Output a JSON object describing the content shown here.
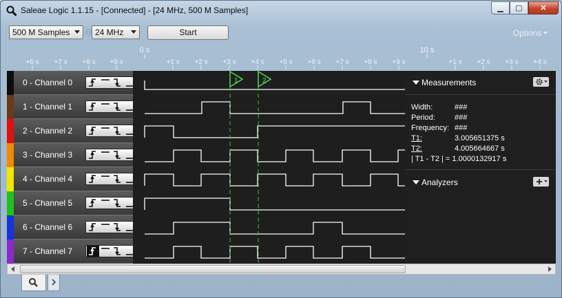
{
  "window": {
    "title": "Saleae Logic 1.1.15 - [Connected] - [24 MHz, 500 M Samples]"
  },
  "toolbar": {
    "samples_value": "500 M Samples",
    "at_sign": "@",
    "rate_value": "24 MHz",
    "start_label": "Start",
    "options_label": "Options"
  },
  "ruler": {
    "top_labels": [
      "0 s",
      "10 s"
    ],
    "ticks": [
      "+6 s",
      "+7 s",
      "+8 s",
      "+9 s",
      "+1 s",
      "+2 s",
      "+3 s",
      "+4 s",
      "+5 s",
      "+6 s",
      "+7 s",
      "+8 s",
      "+9 s",
      "+1 s",
      "+2 s",
      "+3 s",
      "+4 s"
    ],
    "markers": [
      "1",
      "2"
    ]
  },
  "channels": [
    {
      "label": "0 - Channel 0",
      "color": "#0d0d0d"
    },
    {
      "label": "1 - Channel 1",
      "color": "#6b3a1a"
    },
    {
      "label": "2 - Channel 2",
      "color": "#e01010"
    },
    {
      "label": "3 - Channel 3",
      "color": "#f08a00"
    },
    {
      "label": "4 - Channel 4",
      "color": "#f2e600"
    },
    {
      "label": "5 - Channel 5",
      "color": "#1fc21f"
    },
    {
      "label": "6 - Channel 6",
      "color": "#1533d6"
    },
    {
      "label": "7 - Channel 7",
      "color": "#8a2bc9"
    }
  ],
  "measurements": {
    "title": "Measurements",
    "width_label": "Width:",
    "width_value": "###",
    "period_label": "Period:",
    "period_value": "###",
    "frequency_label": "Frequency:",
    "frequency_value": "###",
    "t1_label": "T1:",
    "t1_value": "3.005651375 s",
    "t2_label": "T2:",
    "t2_value": "4.005664667 s",
    "diff_text": "| T1 - T2 | = 1.0000132917 s"
  },
  "analyzers": {
    "title": "Analyzers"
  }
}
